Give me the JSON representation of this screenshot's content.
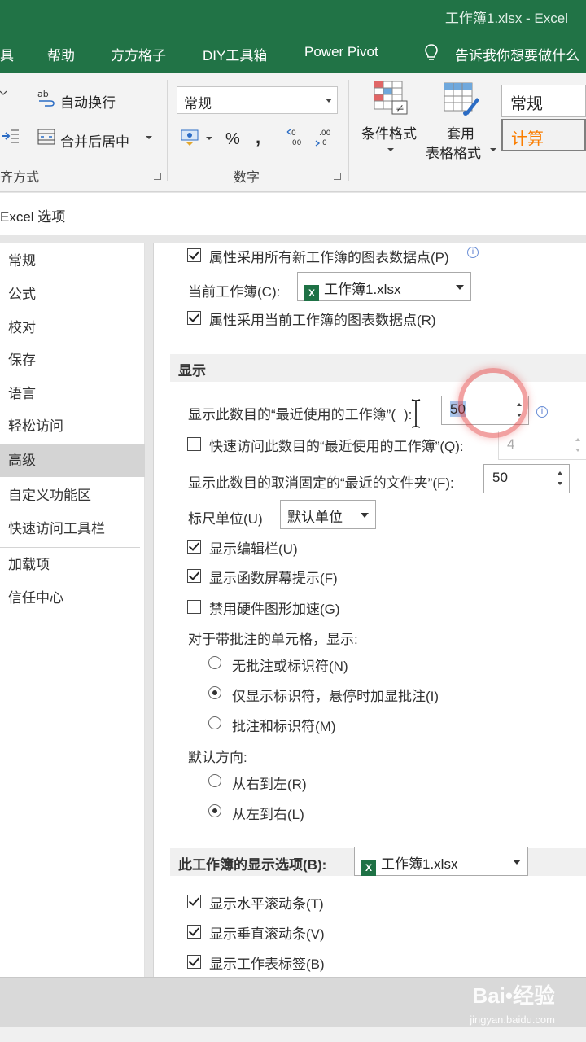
{
  "window_title": "工作簿1.xlsx  -  Excel",
  "menu_tabs": [
    "具",
    "帮助",
    "方方格子",
    "DIY工具箱",
    "Power Pivot",
    "告诉我你想要做什么"
  ],
  "ribbon": {
    "wrap_text": "自动换行",
    "merge_center": "合并后居中",
    "alignment_group": "齐方式",
    "number_format": "常规",
    "percent": "%",
    "comma": ",",
    "number_group": "数字",
    "conditional_format": "条件格式",
    "table_format_1": "套用",
    "table_format_2": "表格格式",
    "style_normal": "常规",
    "style_calc": "计算"
  },
  "dialog_title": "Excel 选项",
  "sidebar": [
    {
      "label": "常规",
      "selected": false
    },
    {
      "label": "公式",
      "selected": false
    },
    {
      "label": "校对",
      "selected": false
    },
    {
      "label": "保存",
      "selected": false
    },
    {
      "label": "语言",
      "selected": false
    },
    {
      "label": "轻松访问",
      "selected": false
    },
    {
      "label": "高级",
      "selected": true
    },
    {
      "label": "自定义功能区",
      "selected": false
    },
    {
      "label": "快速访问工具栏",
      "selected": false
    },
    {
      "label": "加载项",
      "selected": false
    },
    {
      "label": "信任中心",
      "selected": false
    }
  ],
  "options": {
    "chart_all_workbooks": "属性采用所有新工作簿的图表数据点(P)",
    "current_workbook_label": "当前工作簿(C):",
    "current_workbook_value": "工作簿1.xlsx",
    "chart_current_workbook": "属性采用当前工作簿的图表数据点(R)",
    "display_section": "显示",
    "recent_workbooks_label": "显示此数目的“最近使用的工作簿”(",
    "recent_workbooks_label_end": "):",
    "recent_workbooks_value": "50",
    "quick_access_recent": "快速访问此数目的“最近使用的工作簿”(Q):",
    "quick_access_value": "4",
    "unpinned_folders_label": "显示此数目的取消固定的“最近的文件夹”(F):",
    "unpinned_folders_value": "50",
    "ruler_units_label": "标尺单位(U)",
    "ruler_units_value": "默认单位",
    "show_formula_bar": "显示编辑栏(U)",
    "show_function_tips": "显示函数屏幕提示(F)",
    "disable_hw_accel": "禁用硬件图形加速(G)",
    "comments_label": "对于带批注的单元格，显示:",
    "no_comments": "无批注或标识符(N)",
    "indicators_only": "仅显示标识符，悬停时加显批注(I)",
    "comments_and_indicators": "批注和标识符(M)",
    "default_direction_label": "默认方向:",
    "right_to_left": "从右到左(R)",
    "left_to_right": "从左到右(L)",
    "workbook_display_section": "此工作簿的显示选项(B):",
    "workbook_display_value": "工作簿1.xlsx",
    "show_hscroll": "显示水平滚动条(T)",
    "show_vscroll": "显示垂直滚动条(V)",
    "show_sheet_tabs": "显示工作表标签(B)"
  },
  "watermark": {
    "main": "Bai•经验",
    "sub": "jingyan.baidu.com"
  },
  "colors": {
    "excel_green": "#217346",
    "accent_ring": "#e54444",
    "selected_sidebar": "#d4d4d4"
  }
}
